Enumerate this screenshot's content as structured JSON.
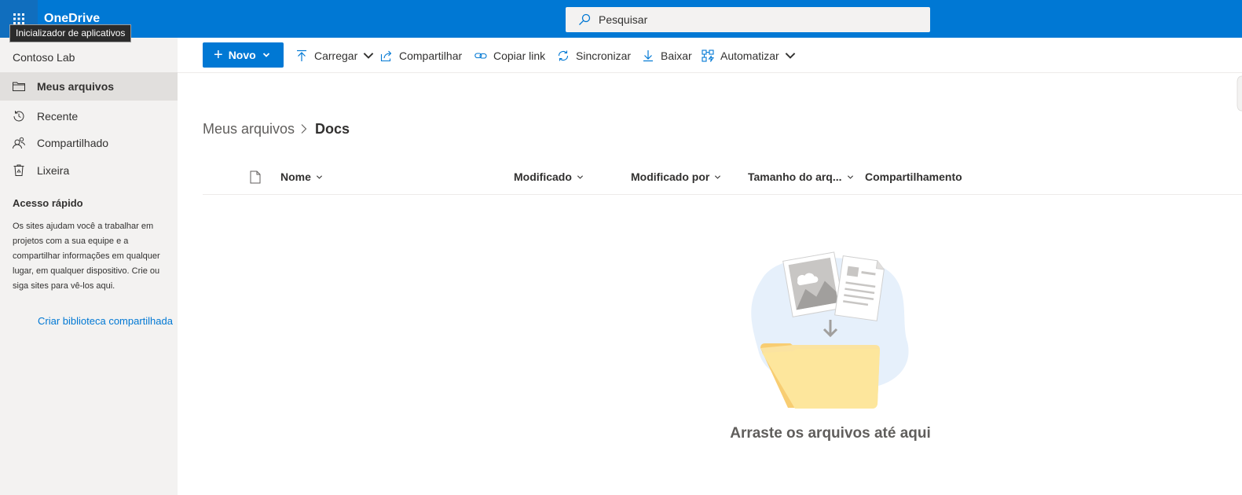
{
  "app": {
    "brand": "OneDrive",
    "waffle_icon": "waffle-grid-icon",
    "tooltip": "Inicializador de aplicativos",
    "search": {
      "placeholder": "Pesquisar",
      "icon": "search-icon"
    },
    "accent": "#0078d4"
  },
  "sidebar": {
    "org": "Contoso Lab",
    "items": [
      {
        "label": "Meus arquivos",
        "icon": "folder-icon",
        "active": true
      },
      {
        "label": "Recente",
        "icon": "history-icon"
      },
      {
        "label": "Compartilhado",
        "icon": "people-icon"
      },
      {
        "label": "Lixeira",
        "icon": "recycle-bin-icon"
      }
    ],
    "quick_access": {
      "title": "Acesso rápido",
      "description": "Os sites ajudam você a trabalhar em projetos com a sua equipe e a compartilhar informações em qualquer lugar, em qualquer dispositivo. Crie ou siga sites para vê-los aqui.",
      "link": "Criar biblioteca compartilhada"
    }
  },
  "toolbar": {
    "new_label": "Novo",
    "upload_label": "Carregar",
    "share_label": "Compartilhar",
    "copy_link_label": "Copiar link",
    "sync_label": "Sincronizar",
    "download_label": "Baixar",
    "automate_label": "Automatizar"
  },
  "breadcrumb": {
    "root": "Meus arquivos",
    "current": "Docs"
  },
  "table": {
    "columns": [
      "Nome",
      "Modificado",
      "Modificado por",
      "Tamanho do arq...",
      "Compartilhamento"
    ],
    "rows": []
  },
  "empty_state": {
    "message": "Arraste os arquivos até aqui",
    "illustration": "upload-folder-illustration"
  }
}
